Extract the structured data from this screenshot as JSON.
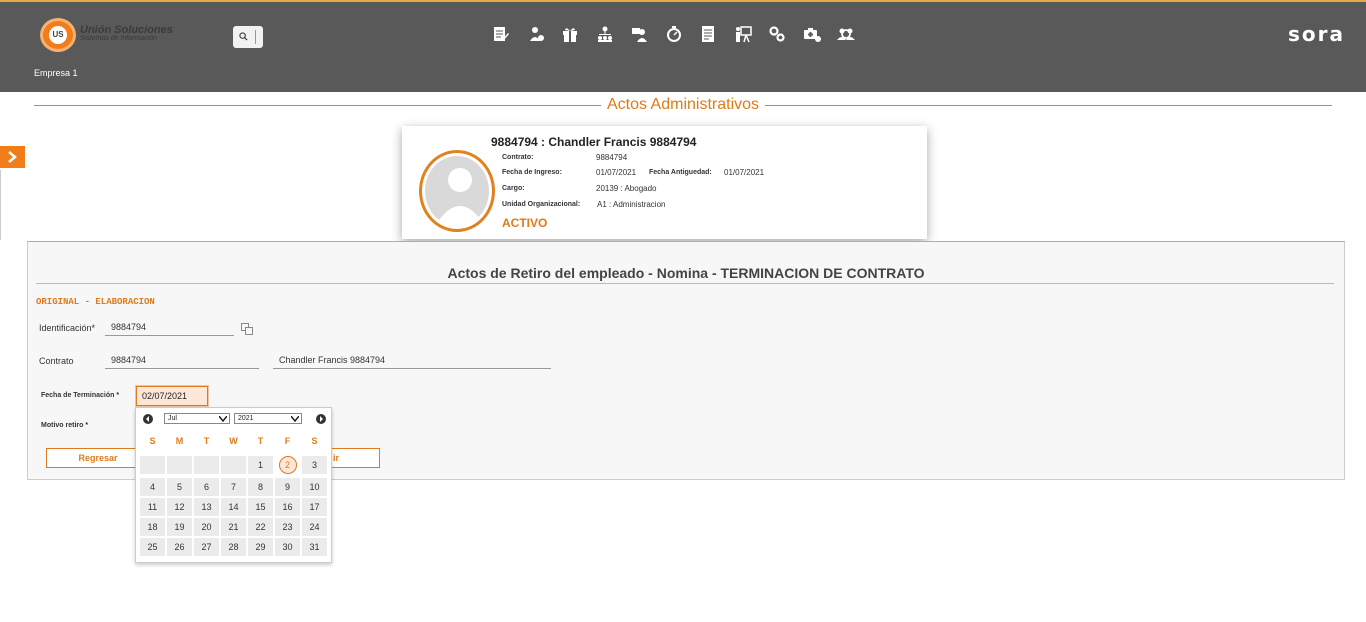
{
  "header": {
    "logo_mark": "US",
    "logo_title": "Unión Soluciones",
    "logo_subtitle": "Sistemas de Información",
    "company": "Empresa 1",
    "brand": "sora",
    "toolbar_icons": [
      "edit-document-icon",
      "person-money-icon",
      "gift-icon",
      "org-chart-icon",
      "person-card-icon",
      "stopwatch-icon",
      "report-icon",
      "presentation-icon",
      "gears-icon",
      "health-kit-icon",
      "group-search-icon"
    ]
  },
  "page": {
    "title": "Actos Administrativos"
  },
  "employee": {
    "name": "9884794 : Chandler Francis 9884794",
    "contrato_label": "Contrato:",
    "contrato_value": "9884794",
    "ingreso_label": "Fecha de Ingreso:",
    "ingreso_value": "01/07/2021",
    "antiguedad_label": "Fecha Antiguedad:",
    "antiguedad_value": "01/07/2021",
    "cargo_label": "Cargo:",
    "cargo_value": "20139 : Abogado",
    "unidad_label": "Unidad Organizacional:",
    "unidad_value": "A1 : Administracion",
    "status": "ACTIVO"
  },
  "form": {
    "title": "Actos de Retiro del empleado - Nomina - TERMINACION DE CONTRATO",
    "state": "ORIGINAL - ELABORACION",
    "identificacion_label": "Identificación*",
    "identificacion_value": "9884794",
    "contrato_label": "Contrato",
    "contrato_value": "9884794",
    "contrato_name": "Chandler Francis 9884794",
    "fecha_label": "Fecha de Terminación *",
    "fecha_value": "02/07/2021",
    "motivo_label": "Motivo retiro *",
    "back_button": "Regresar",
    "other_button_partial": "ir"
  },
  "calendar": {
    "month": "Jul",
    "year": "2021",
    "weekdays": [
      "S",
      "M",
      "T",
      "W",
      "T",
      "F",
      "S"
    ],
    "selected_day": "2",
    "weeks": [
      [
        "",
        "",
        "",
        "",
        "1",
        "2",
        "3"
      ],
      [
        "4",
        "5",
        "6",
        "7",
        "8",
        "9",
        "10"
      ],
      [
        "11",
        "12",
        "13",
        "14",
        "15",
        "16",
        "17"
      ],
      [
        "18",
        "19",
        "20",
        "21",
        "22",
        "23",
        "24"
      ],
      [
        "25",
        "26",
        "27",
        "28",
        "29",
        "30",
        "31"
      ]
    ]
  },
  "colors": {
    "accent": "#e07a1a",
    "header_bg": "#595959"
  }
}
